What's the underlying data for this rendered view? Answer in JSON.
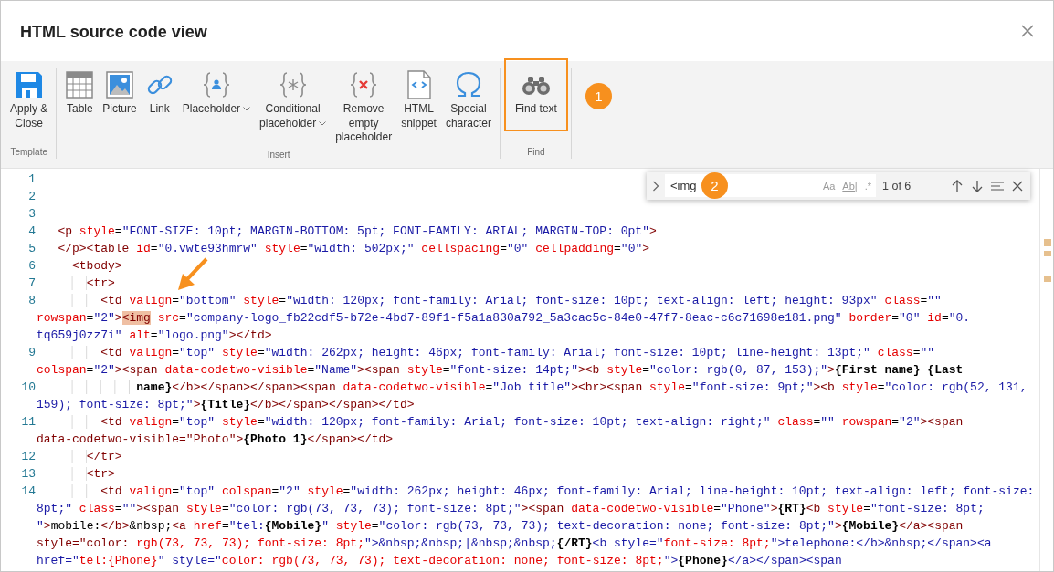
{
  "dialog": {
    "title": "HTML source code view"
  },
  "ribbon": {
    "groups": [
      {
        "label": "Template",
        "items": [
          {
            "label": "Apply &\nClose",
            "has_menu": false,
            "highlighted": false
          }
        ]
      },
      {
        "label": "Insert",
        "items": [
          {
            "label": "Table",
            "has_menu": false,
            "highlighted": false
          },
          {
            "label": "Picture",
            "has_menu": false,
            "highlighted": false
          },
          {
            "label": "Link",
            "has_menu": false,
            "highlighted": false
          },
          {
            "label": "Placeholder",
            "has_menu": true,
            "highlighted": false
          },
          {
            "label": "Conditional\nplaceholder",
            "has_menu": true,
            "highlighted": false
          },
          {
            "label": "Remove\nempty\nplaceholder",
            "has_menu": false,
            "highlighted": false
          },
          {
            "label": "HTML\nsnippet",
            "has_menu": false,
            "highlighted": false
          },
          {
            "label": "Special\ncharacter",
            "has_menu": false,
            "highlighted": false
          }
        ]
      },
      {
        "label": "Find",
        "items": [
          {
            "label": "Find text",
            "has_menu": false,
            "highlighted": true
          }
        ]
      }
    ]
  },
  "find": {
    "value": "<img",
    "options": [
      {
        "label": "Aa",
        "on": false
      },
      {
        "label": "Ab|",
        "on": false
      },
      {
        "label": ".*",
        "on": false
      }
    ],
    "match_count": "1 of 6"
  },
  "editor": {
    "lines": [
      {
        "number": "1"
      },
      {
        "number": "2"
      },
      {
        "number": "3"
      },
      {
        "number": "4",
        "segments": [
          "   <p style=\"FONT-SIZE: 10pt; MARGIN-BOTTOM: 5pt; FONT-FAMILY: ARIAL; MARGIN-TOP: 0pt\">"
        ]
      },
      {
        "number": "5",
        "segments": [
          "   </p><table id=\"0.vwte93hmrw\" style=\"width: 502px;\" cellspacing=\"0\" cellpadding=\"0\">"
        ]
      },
      {
        "number": "6",
        "segments": [
          "     <tbody>"
        ]
      },
      {
        "number": "7",
        "segments": [
          "       <tr>"
        ]
      },
      {
        "number": "8",
        "segments": [
          "         <td valign=\"bottom\" style=\"width: 120px; font-family: Arial; font-size: 10pt; text-align: left; height: 93px\" class=\"\"",
          "rowspan=\"2\"><img src=\"company-logo_fb22cdf5-b72e-4bd7-89f1-f5a1a830a792_5a3cac5c-84e0-47f7-8eac-c6c71698e181.png\" border=\"0\" id=\"0.",
          "tq659j0zz7i\" alt=\"logo.png\"></td>"
        ]
      },
      {
        "number": "9",
        "segments": [
          "         <td valign=\"top\" style=\"width: 262px; height: 46px; font-family: Arial; font-size: 10pt; line-height: 13pt;\" class=\"\"",
          "colspan=\"2\"><span data-codetwo-visible=\"Name\"><span style=\"font-size: 14pt;\"><b style=\"color: rgb(0, 87, 153);\">{First name} {Last"
        ]
      },
      {
        "number": "10",
        "segments": [
          "              name}</b></span></span><span data-codetwo-visible=\"Job title\"><br><span style=\"font-size: 9pt;\"><b style=\"color: rgb(52, 131,",
          "159); font-size: 8pt;\">{Title}</b></span></span></td>"
        ]
      },
      {
        "number": "11",
        "segments": [
          "         <td valign=\"top\" style=\"width: 120px; font-family: Arial; font-size: 10pt; text-align: right;\" class=\"\" rowspan=\"2\"><span",
          "data-codetwo-visible=\"Photo\">{Photo 1}</span></td>"
        ]
      },
      {
        "number": "12",
        "segments": [
          "       </tr>"
        ]
      },
      {
        "number": "13",
        "segments": [
          "       <tr>"
        ]
      },
      {
        "number": "14",
        "segments": [
          "         <td valign=\"top\" colspan=\"2\" style=\"width: 262px; height: 46px; font-family: Arial; line-height: 10pt; text-align: left; font-size:",
          "8pt;\" class=\"\"><span style=\"color: rgb(73, 73, 73); font-size: 8pt;\"><span data-codetwo-visible=\"Phone\">{RT}<b style=\"font-size: 8pt;",
          "\">mobile:</b>&nbsp;<a href=\"tel:{Mobile}\" style=\"color: rgb(73, 73, 73); text-decoration: none; font-size: 8pt;\">{Mobile}</a><span",
          "style=\"color: rgb(73, 73, 73); font-size: 8pt;\">&nbsp;&nbsp;|&nbsp;&nbsp;{/RT}<b style=\"font-size: 8pt;\">telephone:</b>&nbsp;</span><a",
          "href=\"tel:{Phone}\" style=\"color: rgb(73, 73, 73); text-decoration: none; font-size: 8pt;\">{Phone}</a></span><span"
        ]
      }
    ]
  },
  "annotations": {
    "badges": [
      "1",
      "2"
    ]
  }
}
